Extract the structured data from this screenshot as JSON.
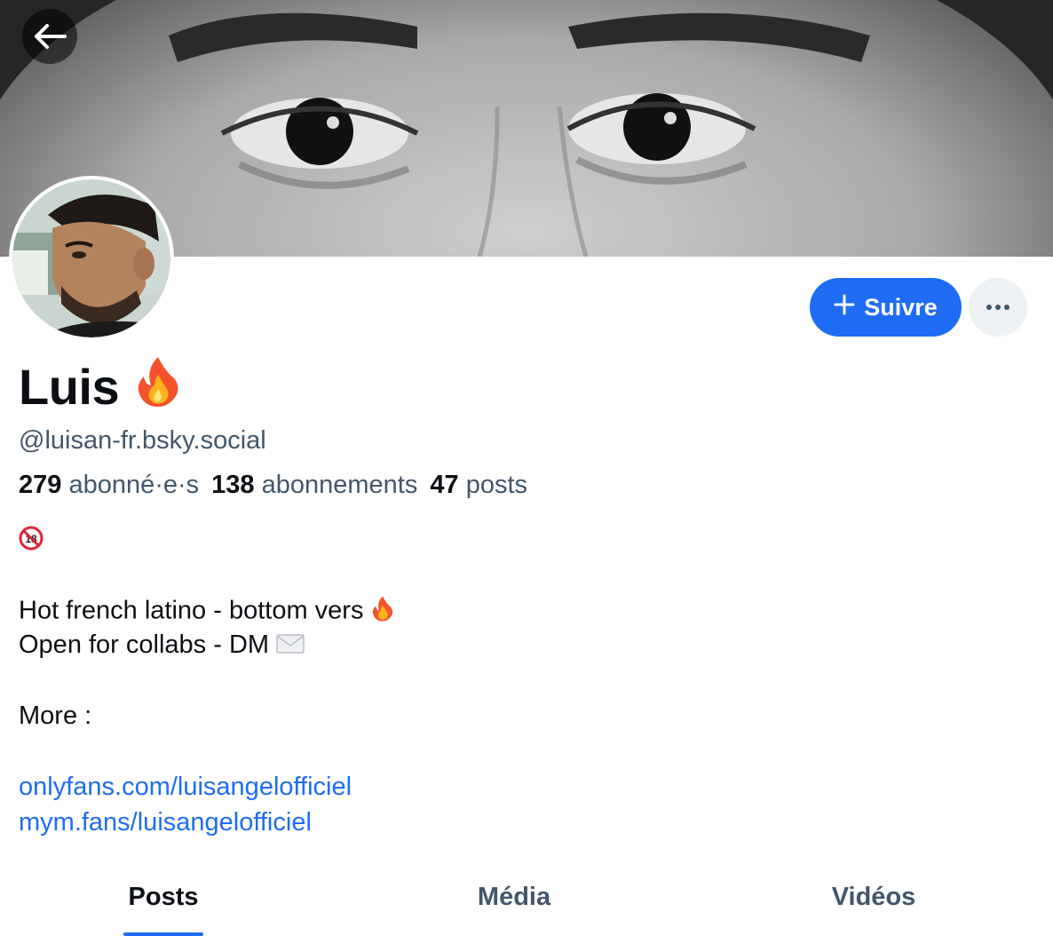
{
  "header": {
    "back_icon": "arrow-left-icon"
  },
  "profile": {
    "display_name": "Luis",
    "name_emoji_icon": "fire-emoji-icon",
    "handle": "@luisan-fr.bsky.social",
    "follow_label": "Suivre",
    "follow_icon": "plus-icon",
    "more_icon": "ellipsis-icon",
    "stats": {
      "followers_count": "279",
      "followers_label": "abonné·e·s",
      "following_count": "138",
      "following_label": "abonnements",
      "posts_count": "47",
      "posts_label": "posts"
    },
    "bio": {
      "age_badge_icon": "no-under-18-emoji-icon",
      "line1": "Hot french latino - bottom vers",
      "line1_emoji_icon": "fire-emoji-icon",
      "line2": "Open for collabs - DM",
      "line2_emoji_icon": "envelope-emoji-icon",
      "line3": "More :",
      "link1": "onlyfans.com/luisangelofficiel",
      "link2": "mym.fans/luisangelofficiel"
    }
  },
  "tabs": [
    {
      "label": "Posts",
      "active": true
    },
    {
      "label": "Média",
      "active": false
    },
    {
      "label": "Vidéos",
      "active": false
    }
  ],
  "colors": {
    "accent": "#1f6cf4",
    "secondary_text": "#42576c",
    "more_button_bg": "#eef1f4"
  }
}
